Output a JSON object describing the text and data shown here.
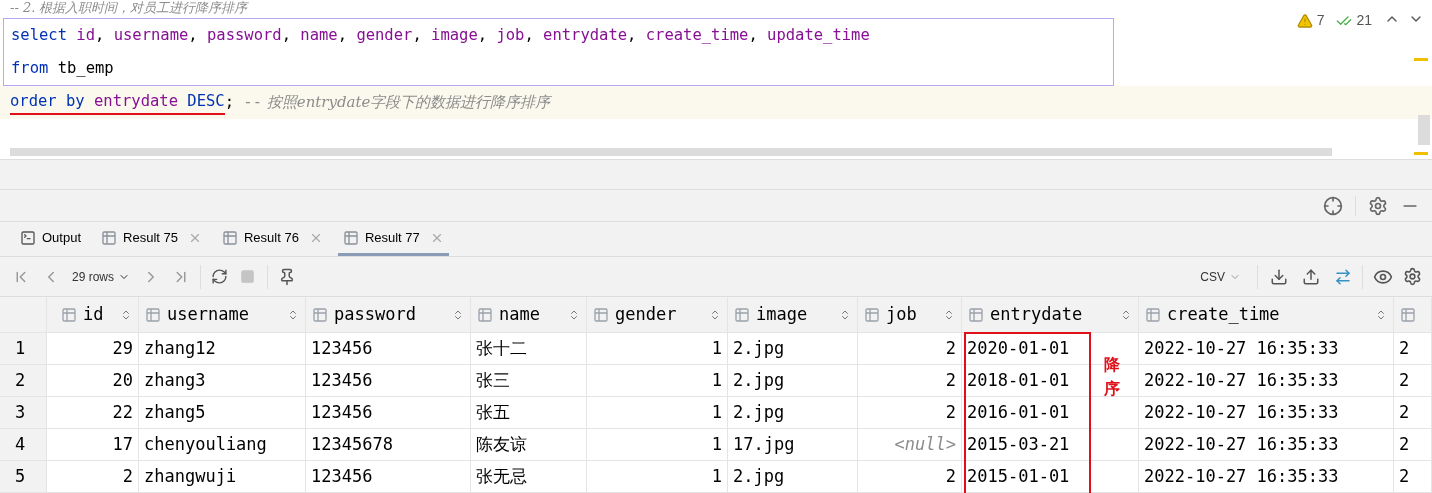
{
  "editor": {
    "comment_line": "-- 2. 根据入职时间，对员工进行降序排序",
    "selected_lines": [
      {
        "tokens": [
          {
            "kind": "keyword",
            "text": "select"
          },
          {
            "kind": "field",
            "text": " id"
          },
          {
            "kind": "plain",
            "text": ","
          },
          {
            "kind": "field",
            "text": " username"
          },
          {
            "kind": "plain",
            "text": ","
          },
          {
            "kind": "field",
            "text": " password"
          },
          {
            "kind": "plain",
            "text": ","
          },
          {
            "kind": "field",
            "text": " name"
          },
          {
            "kind": "plain",
            "text": ","
          },
          {
            "kind": "field",
            "text": " gender"
          },
          {
            "kind": "plain",
            "text": ","
          },
          {
            "kind": "field",
            "text": " image"
          },
          {
            "kind": "plain",
            "text": ","
          },
          {
            "kind": "field",
            "text": " job"
          },
          {
            "kind": "plain",
            "text": ","
          },
          {
            "kind": "field",
            "text": " entrydate"
          },
          {
            "kind": "plain",
            "text": ","
          },
          {
            "kind": "field",
            "text": " create_time"
          },
          {
            "kind": "plain",
            "text": ","
          },
          {
            "kind": "field",
            "text": " update_time"
          }
        ]
      },
      {
        "tokens": [
          {
            "kind": "keyword",
            "text": "from"
          },
          {
            "kind": "plain",
            "text": " tb_emp"
          }
        ]
      }
    ],
    "current_line": {
      "underlined_tokens": [
        {
          "kind": "keyword",
          "text": "order by"
        },
        {
          "kind": "field",
          "text": " entrydate"
        },
        {
          "kind": "keyword",
          "text": " DESC"
        }
      ],
      "tail": [
        {
          "kind": "plain",
          "text": ";"
        },
        {
          "kind": "comment",
          "text": " --"
        },
        {
          "kind": "comment_italic",
          "text": " 按照entrydate字段下的数据进行降序排序"
        }
      ]
    },
    "inspections": {
      "warnings": "7",
      "checks": "21"
    }
  },
  "results": {
    "tabs": [
      {
        "kind": "output",
        "label": "Output",
        "selected": false
      },
      {
        "kind": "result",
        "label": "Result 75",
        "selected": false
      },
      {
        "kind": "result",
        "label": "Result 76",
        "selected": false
      },
      {
        "kind": "result",
        "label": "Result 77",
        "selected": true
      }
    ],
    "toolbar": {
      "rows": "29 rows",
      "format": "CSV"
    },
    "table": {
      "columns": [
        {
          "name": "id"
        },
        {
          "name": "username"
        },
        {
          "name": "password"
        },
        {
          "name": "name"
        },
        {
          "name": "gender"
        },
        {
          "name": "image"
        },
        {
          "name": "job"
        },
        {
          "name": "entrydate"
        },
        {
          "name": "create_time"
        },
        {}
      ],
      "rows": [
        {
          "number": "1",
          "cells": [
            "29",
            "zhang12",
            "123456",
            "张十二",
            "1",
            "2.jpg",
            "2",
            "2020-01-01",
            "2022-10-27 16:35:33",
            "2"
          ]
        },
        {
          "number": "2",
          "cells": [
            "20",
            "zhang3",
            "123456",
            "张三",
            "1",
            "2.jpg",
            "2",
            "2018-01-01",
            "2022-10-27 16:35:33",
            "2"
          ]
        },
        {
          "number": "3",
          "cells": [
            "22",
            "zhang5",
            "123456",
            "张五",
            "1",
            "2.jpg",
            "2",
            "2016-01-01",
            "2022-10-27 16:35:33",
            "2"
          ]
        },
        {
          "number": "4",
          "cells": [
            "17",
            "chenyouliang",
            "12345678",
            "陈友谅",
            "1",
            "17.jpg",
            {
              "text": "<null>",
              "null": true
            },
            "2015-03-21",
            "2022-10-27 16:35:33",
            "2"
          ]
        },
        {
          "number": "5",
          "cells": [
            "2",
            "zhangwuji",
            "123456",
            "张无忌",
            "1",
            "2.jpg",
            "2",
            "2015-01-01",
            "2022-10-27 16:35:33",
            "2"
          ]
        }
      ],
      "annotation": "降序"
    }
  }
}
